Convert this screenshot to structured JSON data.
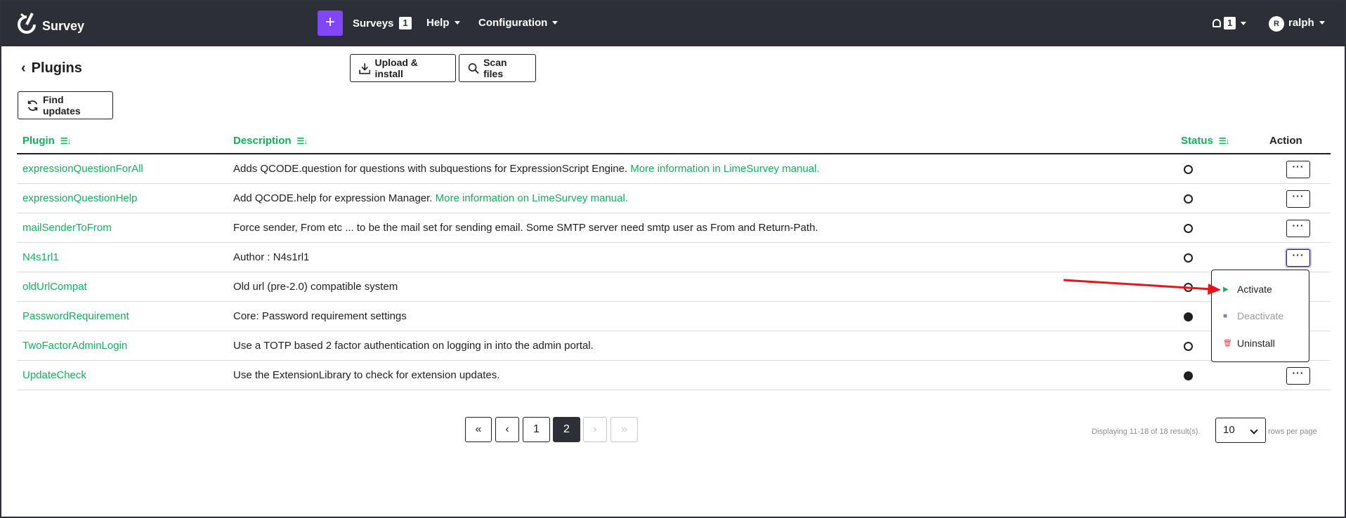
{
  "nav": {
    "brand": "Survey",
    "plus": "+",
    "surveys": "Surveys",
    "surveys_count": "1",
    "help": "Help",
    "configuration": "Configuration",
    "notifications_count": "1",
    "avatar_initial": "R",
    "user": "ralph"
  },
  "header": {
    "back": "‹",
    "title": "Plugins",
    "upload_install": "Upload & install",
    "scan_files": "Scan files",
    "find_updates": "Find updates"
  },
  "table": {
    "columns": {
      "plugin": "Plugin",
      "description": "Description",
      "status": "Status",
      "action": "Action"
    },
    "action_label": "···",
    "rows": [
      {
        "plugin": "expressionQuestionForAll",
        "description": "Adds QCODE.question for questions with subquestions for ExpressionScript Engine. ",
        "link": "More information in LimeSurvey manual.",
        "active": false
      },
      {
        "plugin": "expressionQuestionHelp",
        "description": "Add QCODE.help for expression Manager. ",
        "link": "More information on LimeSurvey manual.",
        "active": false
      },
      {
        "plugin": "mailSenderToFrom",
        "description": "Force sender, From etc ... to be the mail set for sending email. Some SMTP server need smtp user as From and Return-Path.",
        "link": "",
        "active": false
      },
      {
        "plugin": "N4s1rl1",
        "description": "Author : N4s1rl1",
        "link": "",
        "active": false
      },
      {
        "plugin": "oldUrlCompat",
        "description": "Old url (pre-2.0) compatible system",
        "link": "",
        "active": false
      },
      {
        "plugin": "PasswordRequirement",
        "description": "Core: Password requirement settings",
        "link": "",
        "active": true
      },
      {
        "plugin": "TwoFactorAdminLogin",
        "description": "Use a TOTP based 2 factor authentication on logging in into the admin portal.",
        "link": "",
        "active": false
      },
      {
        "plugin": "UpdateCheck",
        "description": "Use the ExtensionLibrary to check for extension updates.",
        "link": "",
        "active": true
      }
    ]
  },
  "dropdown": {
    "activate": "Activate",
    "deactivate": "Deactivate",
    "uninstall": "Uninstall"
  },
  "pagination": {
    "first": "«",
    "prev": "‹",
    "page1": "1",
    "page2": "2",
    "next": "›",
    "last": "»",
    "displaying": "Displaying 11-18 of 18 result(s).",
    "page_size": "10",
    "rows_per_page": "rows per page"
  },
  "colors": {
    "accent_green": "#14ae5c",
    "nav_bg": "#2c2f36",
    "plus_purple": "#8146f6",
    "arrow_red": "#e8141c"
  }
}
